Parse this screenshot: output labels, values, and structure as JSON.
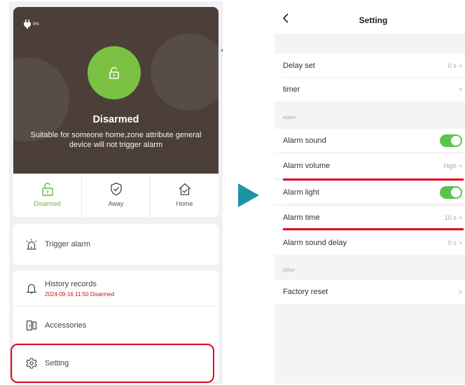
{
  "left": {
    "battery": "0%",
    "status_title": "Disarmed",
    "status_desc": "Suitable for someone home,zone attribute general device will not trigger alarm",
    "modes": [
      {
        "label": "Disarmed",
        "icon": "unlock-icon",
        "active": true
      },
      {
        "label": "Away",
        "icon": "shield-check-icon",
        "active": false
      },
      {
        "label": "Home",
        "icon": "home-check-icon",
        "active": false
      }
    ],
    "menu": {
      "trigger_alarm": "Trigger alarm",
      "history_records": "History records",
      "history_sub": "2024-09-16 11:50 Disarmed",
      "accessories": "Accessories",
      "setting": "Setting"
    },
    "colors": {
      "accent_green": "#7ac142",
      "hero_bg": "#4c3f3a",
      "highlight": "#e2061c",
      "history_sub": "#b8141b"
    }
  },
  "arrow_color": "#1e93a6",
  "right": {
    "title": "Setting",
    "delay_set": {
      "label": "Delay set",
      "value": "0 s"
    },
    "timer": {
      "label": "timer"
    },
    "section_alarm": "Alarm",
    "alarm_sound": {
      "label": "Alarm sound",
      "on": true
    },
    "alarm_volume": {
      "label": "Alarm volume",
      "value": "High"
    },
    "alarm_light": {
      "label": "Alarm light",
      "on": true
    },
    "alarm_time": {
      "label": "Alarm time",
      "value": "10 s"
    },
    "alarm_sound_delay": {
      "label": "Alarm sound delay",
      "value": "0 s"
    },
    "section_other": "Other",
    "factory_reset": {
      "label": "Factory reset"
    },
    "chevron": ">",
    "colors": {
      "toggle_on": "#5bc44c",
      "underline": "#e2061c"
    }
  }
}
